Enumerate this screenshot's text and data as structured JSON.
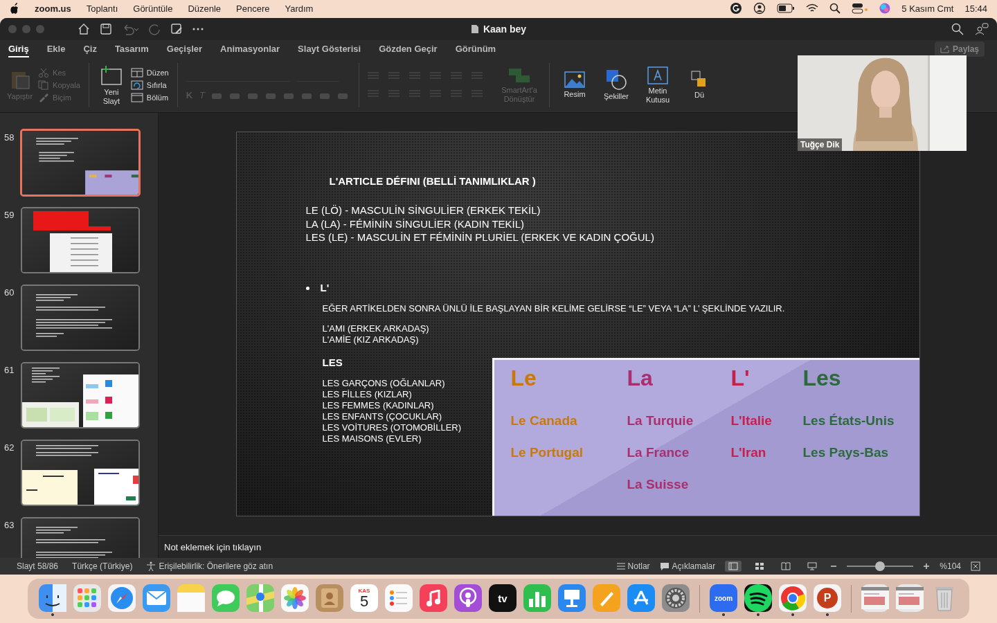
{
  "menubar": {
    "app": "zoom.us",
    "menus": [
      "Toplantı",
      "Görüntüle",
      "Düzenle",
      "Pencere",
      "Yardım"
    ],
    "date": "5 Kasım Cmt",
    "time": "15:44"
  },
  "window": {
    "title": "Kaan bey"
  },
  "tabs": [
    {
      "label": "Giriş",
      "selected": true
    },
    {
      "label": "Ekle",
      "selected": false
    },
    {
      "label": "Çiz",
      "selected": false
    },
    {
      "label": "Tasarım",
      "selected": false
    },
    {
      "label": "Geçişler",
      "selected": false
    },
    {
      "label": "Animasyonlar",
      "selected": false
    },
    {
      "label": "Slayt Gösterisi",
      "selected": false
    },
    {
      "label": "Gözden Geçir",
      "selected": false
    },
    {
      "label": "Görünüm",
      "selected": false
    }
  ],
  "share_button": {
    "label": "Paylaş",
    "disabled": true
  },
  "ribbon": {
    "paste": {
      "label": "Yapıştır",
      "disabled": true
    },
    "clipboard": [
      {
        "kind": "cut",
        "label": "Kes",
        "disabled": true
      },
      {
        "kind": "copy",
        "label": "Kopyala",
        "disabled": true
      },
      {
        "kind": "format",
        "label": "Biçim",
        "disabled": true
      }
    ],
    "new_slide": {
      "label": "Yeni Slayt"
    },
    "slide_tools": [
      {
        "kind": "layout",
        "label": "Düzen"
      },
      {
        "kind": "reset",
        "label": "Sıfırla"
      },
      {
        "kind": "section",
        "label": "Bölüm"
      }
    ],
    "format_buttons": [
      {
        "label": "K"
      },
      {
        "label": "T"
      }
    ],
    "convert": {
      "label": "SmartArt'a Dönüştür",
      "disabled": true
    },
    "insert": [
      {
        "kind": "picture",
        "label": "Resim"
      },
      {
        "kind": "shapes",
        "label": "Şekiller"
      },
      {
        "kind": "textbox",
        "label": "Metin Kutusu"
      },
      {
        "kind": "arrange",
        "label": "Dü"
      }
    ]
  },
  "thumbnails": [
    {
      "number": "58",
      "kind": "text-table",
      "selected": true
    },
    {
      "number": "59",
      "kind": "red-table",
      "selected": false
    },
    {
      "number": "60",
      "kind": "text",
      "selected": false
    },
    {
      "number": "61",
      "kind": "text-charts",
      "selected": false
    },
    {
      "number": "62",
      "kind": "text-vocab",
      "selected": false
    },
    {
      "number": "63",
      "kind": "text",
      "selected": false
    }
  ],
  "slide": {
    "title": "L'ARTICLE DÉFINI (BELLİ TANIMLIKLAR )",
    "definitions": [
      "LE (LÖ) - MASCULİN SİNGULİER (ERKEK TEKİL)",
      "LA (LA) - FÉMİNİN SİNGULİER (KADIN TEKİL)",
      "LES (LE) - MASCULİN ET FÉMİNİN PLURİEL (ERKEK VE KADIN ÇOĞUL)"
    ],
    "bullet": "L'",
    "rule": "EĞER ARTİKELDEN SONRA ÜNLÜ İLE BAŞLAYAN BİR KELİME GELİRSE “LE” VEYA “LA” L’ ŞEKLİNDE YAZILIR.",
    "examples": [
      "L'AMI (ERKEK ARKADAŞ)",
      "L'AMİE (KIZ ARKADAŞ)"
    ],
    "plural_heading": "LES",
    "plural_examples": [
      "LES GARÇONS (OĞLANLAR)",
      "LES FİLLES (KIZLAR)",
      "LES FEMMES (KADINLAR)",
      "LES ENFANTS (ÇOCUKLAR)",
      "LES VOİTURES (OTOMOBİLLER)",
      "LES MAISONS (EVLER)"
    ],
    "articles_image": [
      {
        "header": "Le",
        "color": "#c9780e",
        "items": [
          "Le Canada",
          "Le Portugal"
        ]
      },
      {
        "header": "La",
        "color": "#a8306e",
        "items": [
          "La Turquie",
          "La France",
          "La Suisse"
        ]
      },
      {
        "header": "L'",
        "color": "#c8204e",
        "items": [
          "L'Italie",
          "L'Iran"
        ]
      },
      {
        "header": "Les",
        "color": "#2c6a3e",
        "items": [
          "Les États-Unis",
          "Les Pays-Bas"
        ]
      }
    ]
  },
  "notes": {
    "placeholder": "Not eklemek için tıklayın"
  },
  "status_bar": {
    "slide": "Slayt 58/86",
    "language": "Türkçe (Türkiye)",
    "accessibility": "Erişilebilirlik: Önerilere göz atın",
    "notes": "Notlar",
    "comments": "Açıklamalar",
    "views": [
      {
        "kind": "normal",
        "selected": true
      },
      {
        "kind": "sorter",
        "selected": false
      },
      {
        "kind": "reading",
        "selected": false
      },
      {
        "kind": "show",
        "selected": false
      }
    ],
    "zoom": {
      "level": 0.5
    },
    "zoom_value": "%104"
  },
  "video": {
    "name": "Tuğçe Dik"
  },
  "dock": [
    {
      "kind": "finder",
      "running": true
    },
    {
      "kind": "launchpad",
      "running": false
    },
    {
      "kind": "safari",
      "running": false
    },
    {
      "kind": "mail",
      "running": false
    },
    {
      "kind": "notes",
      "running": false
    },
    {
      "kind": "messages",
      "running": false
    },
    {
      "kind": "maps",
      "running": false
    },
    {
      "kind": "photos",
      "running": false
    },
    {
      "kind": "contacts",
      "running": false
    },
    {
      "kind": "calendar",
      "month": "KAS",
      "day": "5",
      "running": false
    },
    {
      "kind": "reminders",
      "running": false
    },
    {
      "kind": "music",
      "running": false
    },
    {
      "kind": "podcasts",
      "running": false
    },
    {
      "kind": "tv",
      "label": "tv",
      "running": false
    },
    {
      "kind": "numbers",
      "running": false
    },
    {
      "kind": "keynote",
      "running": false
    },
    {
      "kind": "pages",
      "running": false
    },
    {
      "kind": "appstore",
      "running": false
    },
    {
      "kind": "settings",
      "running": false
    },
    {
      "kind": "separator"
    },
    {
      "kind": "zoom",
      "label": "zoom",
      "running": true
    },
    {
      "kind": "spotify",
      "running": true
    },
    {
      "kind": "chrome",
      "running": true
    },
    {
      "kind": "powerpoint",
      "label": "P",
      "running": true
    },
    {
      "kind": "separator"
    },
    {
      "kind": "window",
      "running": false
    },
    {
      "kind": "window",
      "running": false
    },
    {
      "kind": "trash",
      "running": false
    }
  ]
}
